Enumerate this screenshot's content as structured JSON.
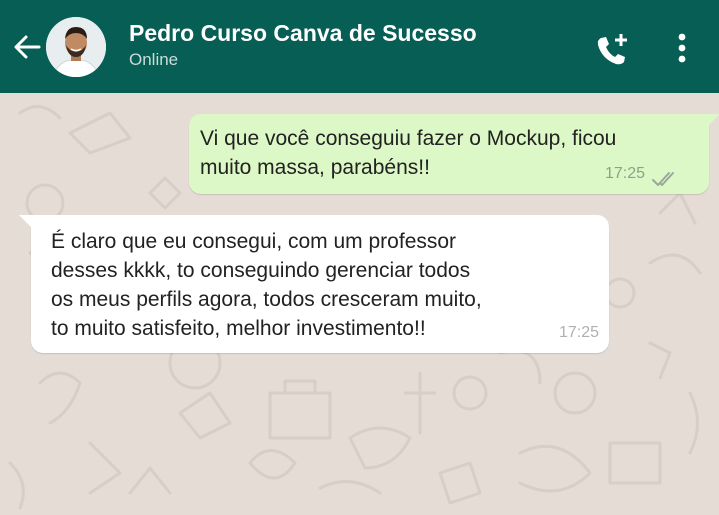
{
  "header": {
    "contact_name": "Pedro Curso Canva de Sucesso",
    "status": "Online",
    "back_icon": "arrow-left-icon",
    "call_icon": "add-call-icon",
    "menu_icon": "more-vertical-icon",
    "color": "#075e54"
  },
  "messages": [
    {
      "direction": "outgoing",
      "text": "Vi que você conseguiu fazer o Mockup, ficou\nmuito massa, parabéns!!",
      "time": "17:25",
      "status_icon": "double-check-icon",
      "color": "#dcf8c6"
    },
    {
      "direction": "incoming",
      "text": "É claro que eu consegui, com um professor\ndesses kkkk, to conseguindo gerenciar todos\nos meus perfils agora, todos cresceram muito,\nto muito satisfeito, melhor investimento!!",
      "time": "17:25",
      "color": "#ffffff"
    }
  ],
  "wallpaper_color": "#e5ddd5"
}
